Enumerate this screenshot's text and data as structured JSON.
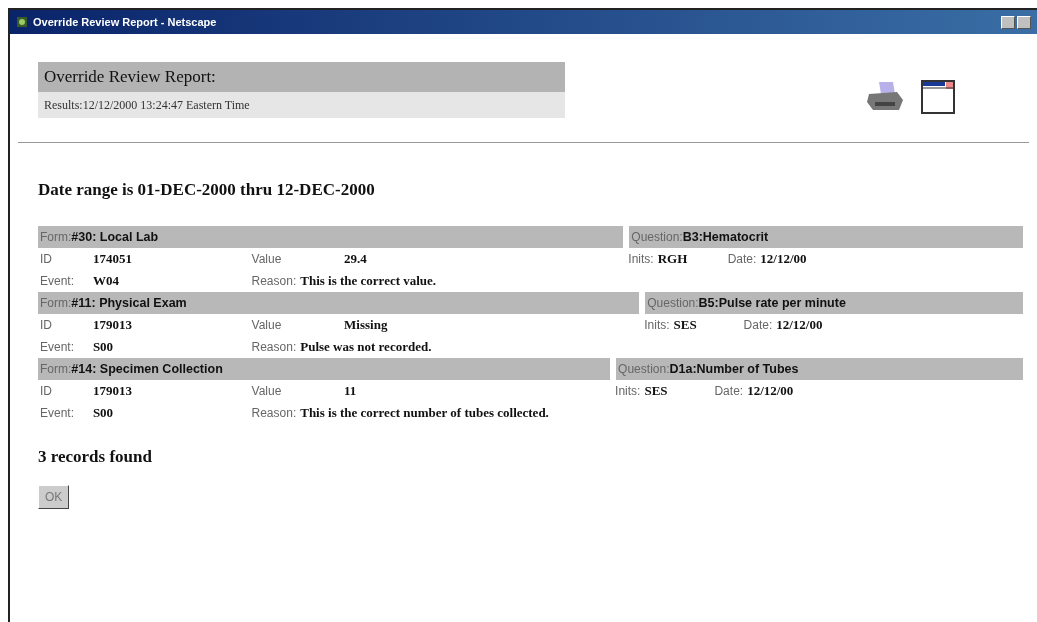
{
  "window": {
    "title": "Override Review Report - Netscape"
  },
  "header": {
    "title": "Override Review Report:",
    "subtitle": "Results:12/12/2000 13:24:47 Eastern Time"
  },
  "date_range": "Date range is 01-DEC-2000 thru 12-DEC-2000",
  "records": [
    {
      "form_label": "Form:",
      "form": "#30: Local Lab",
      "question_label": "Question:",
      "question": "B3:Hematocrit",
      "id_label": "ID",
      "id": "174051",
      "value_label": "Value",
      "value": "29.4",
      "inits_label": "Inits:",
      "inits": "RGH",
      "date_label": "Date:",
      "date": "12/12/00",
      "event_label": "Event:",
      "event": "W04",
      "reason_label": "Reason:",
      "reason": "This is the correct value."
    },
    {
      "form_label": "Form:",
      "form": "#11: Physical Exam",
      "question_label": "Question:",
      "question": "B5:Pulse rate per minute",
      "id_label": "ID",
      "id": "179013",
      "value_label": "Value",
      "value": "Missing",
      "inits_label": "Inits:",
      "inits": "SES",
      "date_label": "Date:",
      "date": "12/12/00",
      "event_label": "Event:",
      "event": "S00",
      "reason_label": "Reason:",
      "reason": "Pulse was not recorded."
    },
    {
      "form_label": "Form:",
      "form": "#14: Specimen Collection",
      "question_label": "Question:",
      "question": "D1a:Number of Tubes",
      "id_label": "ID",
      "id": "179013",
      "value_label": "Value",
      "value": "11",
      "inits_label": "Inits:",
      "inits": "SES",
      "date_label": "Date:",
      "date": "12/12/00",
      "event_label": "Event:",
      "event": "S00",
      "reason_label": "Reason:",
      "reason": "This is the correct number of tubes collected."
    }
  ],
  "summary": "3 records found",
  "buttons": [
    {
      "label": "OK"
    }
  ]
}
